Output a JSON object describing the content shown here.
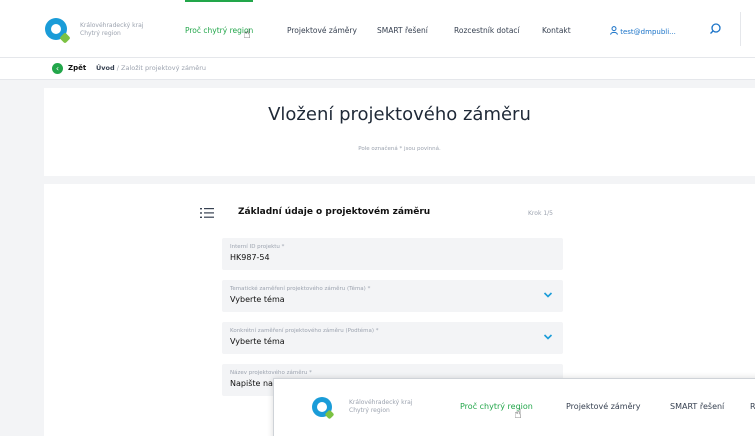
{
  "header": {
    "logo_text": [
      "Královéhradecký kraj",
      "Chytrý region"
    ],
    "nav": [
      {
        "label": "Proč chytrý region",
        "active": true
      },
      {
        "label": "Projektové záměry",
        "active": false
      },
      {
        "label": "SMART řešení",
        "active": false
      },
      {
        "label": "Rozcestník dotací",
        "active": false
      },
      {
        "label": "Kontakt",
        "active": false
      }
    ],
    "user": "test@dmpubli...",
    "icons": [
      "logo-icon",
      "user-icon",
      "search-icon",
      "cursor-hand-icon"
    ]
  },
  "breadcrumb": {
    "back_label": "Zpět",
    "home": "Úvod",
    "separator": "/",
    "current": "Založit projektový záměru"
  },
  "page": {
    "title": "Vložení projektového záměru",
    "required_note": "Pole označená * jsou povinná."
  },
  "section": {
    "title": "Základní údaje o projektovém záměru",
    "step": "Krok 1/5"
  },
  "fields": [
    {
      "label": "Interní ID projektu *",
      "value": "HK987-54",
      "type": "text"
    },
    {
      "label": "Tematické zaměření projektového záměru (Téma) *",
      "value": "Vyberte téma",
      "type": "select"
    },
    {
      "label": "Konkrétní zaměření projektového záměru (Podtéma) *",
      "value": "Vyberte téma",
      "type": "select"
    },
    {
      "label": "Název projektového záměru *",
      "value": "Napište na",
      "type": "text"
    }
  ],
  "overlay": {
    "logo_text": [
      "Královéhradecký kraj",
      "Chytrý region"
    ],
    "nav": [
      "Proč chytrý region",
      "Projektové záměry",
      "SMART řešení",
      "R"
    ]
  },
  "colors": {
    "accent": "#22a64a",
    "brand_blue": "#1a9cd8",
    "link_blue": "#1a73c8"
  }
}
